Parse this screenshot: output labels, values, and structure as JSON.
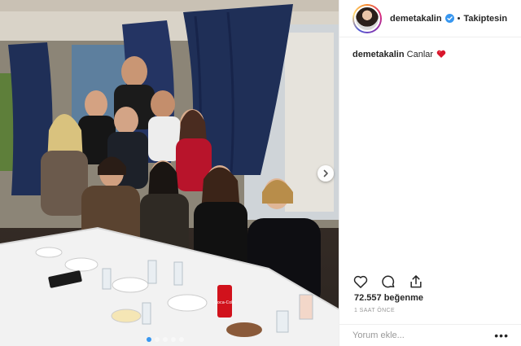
{
  "header": {
    "username": "demetakalin",
    "separator": "•",
    "follow_status": "Takiptesin"
  },
  "caption": {
    "username": "demetakalin",
    "text": "Canlar"
  },
  "photo": {
    "can_label": "Coca-Cola",
    "carousel_dots": 5,
    "active_dot": 1
  },
  "likes": "72.557 beğenme",
  "time": "1 SAAT ÖNCE",
  "comment": {
    "placeholder": "Yorum ekle...",
    "more_label": "•••"
  },
  "colors": {
    "verified": "#3897f0",
    "curtain": "#1f2f57",
    "tablecloth": "#f2f2f2"
  },
  "icons": [
    "heart-icon",
    "comment-icon",
    "share-icon",
    "verified-icon",
    "chevron-right-icon",
    "red-heart-emoji"
  ]
}
